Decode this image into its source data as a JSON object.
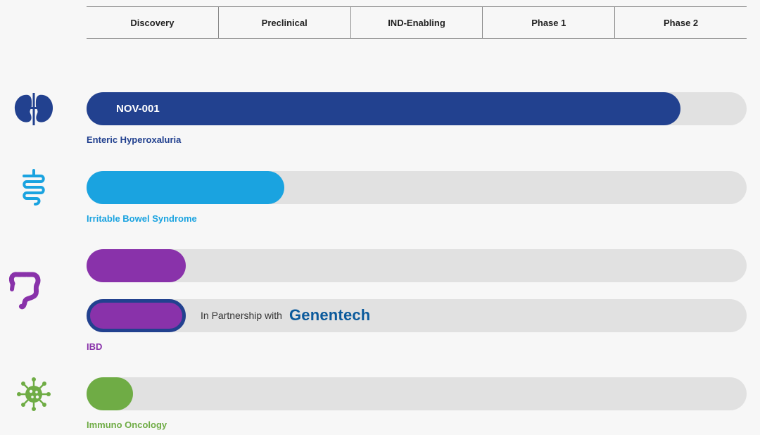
{
  "phases": [
    "Discovery",
    "Preclinical",
    "IND-Enabling",
    "Phase 1",
    "Phase 2"
  ],
  "colors": {
    "kidney": "#22418f",
    "gut": "#1aa3e0",
    "ibd": "#8932aa",
    "oncology": "#6fac45",
    "track": "#e1e1e1",
    "partner_border": "#22418f"
  },
  "chart_data": {
    "type": "bar",
    "orientation": "horizontal",
    "x_axis_categories": [
      "Discovery",
      "Preclinical",
      "IND-Enabling",
      "Phase 1",
      "Phase 2"
    ],
    "programs": [
      {
        "indication": "Enteric Hyperoxaluria",
        "label": "NOV-001",
        "progress_phases": 4.5,
        "icon": "kidney-icon",
        "color": "#22418f"
      },
      {
        "indication": "Irritable Bowel Syndrome",
        "label": "",
        "progress_phases": 1.5,
        "icon": "intestine-icon",
        "color": "#1aa3e0"
      },
      {
        "indication": "IBD",
        "label": "",
        "progress_phases": 0.75,
        "icon": "colon-icon",
        "color": "#8932aa"
      },
      {
        "indication": "IBD",
        "label": "",
        "progress_phases": 0.75,
        "icon": "colon-icon",
        "color": "#8932aa",
        "partner": "Genentech"
      },
      {
        "indication": "Immuno Oncology",
        "label": "",
        "progress_phases": 0.35,
        "icon": "virus-icon",
        "color": "#6fac45"
      }
    ]
  },
  "labels": {
    "nov001": "NOV-001",
    "enteric": "Enteric Hyperoxaluria",
    "ibs": "Irritable Bowel Syndrome",
    "ibd": "IBD",
    "io": "Immuno Oncology",
    "partnership_text": "In Partnership with",
    "partner_logo": "Genentech"
  }
}
